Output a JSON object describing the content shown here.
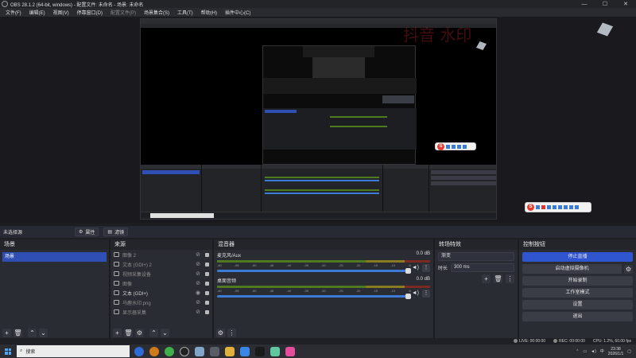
{
  "window": {
    "title": "OBS 28.1.2 (64-bit, windows) - 配置文件: 未命名 - 场景: 未命名"
  },
  "menu": [
    {
      "label": "文件(F)",
      "enabled": true
    },
    {
      "label": "编辑(E)",
      "enabled": true
    },
    {
      "label": "视图(V)",
      "enabled": true
    },
    {
      "label": "停靠窗口(D)",
      "enabled": true
    },
    {
      "label": "配置文件(P)",
      "enabled": false
    },
    {
      "label": "场景集合(S)",
      "enabled": true
    },
    {
      "label": "工具(T)",
      "enabled": true
    },
    {
      "label": "帮助(H)",
      "enabled": true
    },
    {
      "label": "插件中心(C)",
      "enabled": true
    }
  ],
  "context_bar": {
    "no_source": "未选择源",
    "properties": "属性",
    "filters": "滤镜"
  },
  "scenes": {
    "title": "场景",
    "items": [
      "场景"
    ]
  },
  "sources": {
    "title": "来源",
    "items": [
      {
        "name": "图像 2",
        "visible": false
      },
      {
        "name": "文本 (GDI+) 2",
        "visible": false
      },
      {
        "name": "视频采集设备",
        "visible": false
      },
      {
        "name": "图像",
        "visible": false
      },
      {
        "name": "文本 (GDI+)",
        "visible": true
      },
      {
        "name": "马鹿水印.png",
        "visible": false
      },
      {
        "name": "显示器采集",
        "visible": false
      }
    ]
  },
  "mixer": {
    "title": "混音器",
    "ticks": [
      "-60",
      "-55",
      "-50",
      "-45",
      "-40",
      "-35",
      "-30",
      "-25",
      "-20",
      "-15",
      "-10",
      "-5",
      "0"
    ],
    "channels": [
      {
        "name": "麦克风/Aux",
        "db": "0.0 dB"
      },
      {
        "name": "桌面音频",
        "db": "0.0 dB"
      }
    ]
  },
  "transitions": {
    "title": "转场特效",
    "type": "渐变",
    "duration_label": "时长",
    "duration": "300 ms"
  },
  "controls": {
    "title": "控制按钮",
    "buttons": [
      "停止直播",
      "启动虚拟摄像机",
      "开始录制",
      "工作室模式",
      "设置",
      "退出"
    ]
  },
  "status": {
    "live": "LIVE: 00:00:00",
    "rec": "REC: 00:00:00",
    "cpu": "CPU: 1.2%, 60.00 fps"
  },
  "taskbar": {
    "search_placeholder": "搜索",
    "time": "23:38",
    "date": "2026/1/1"
  },
  "colors": {
    "accent": "#2f55cf",
    "scene_selected": "#2f4fb5",
    "panel": "#2a2c33",
    "bg": "#1f1f23"
  },
  "icons": [
    "windows-logo-icon",
    "search-icon",
    "eye-icon",
    "eye-off-icon",
    "lock-icon",
    "gear-icon",
    "speaker-icon",
    "plus-icon",
    "minus-icon",
    "trash-icon",
    "chevron-up-icon",
    "chevron-down-icon",
    "menu-icon"
  ]
}
